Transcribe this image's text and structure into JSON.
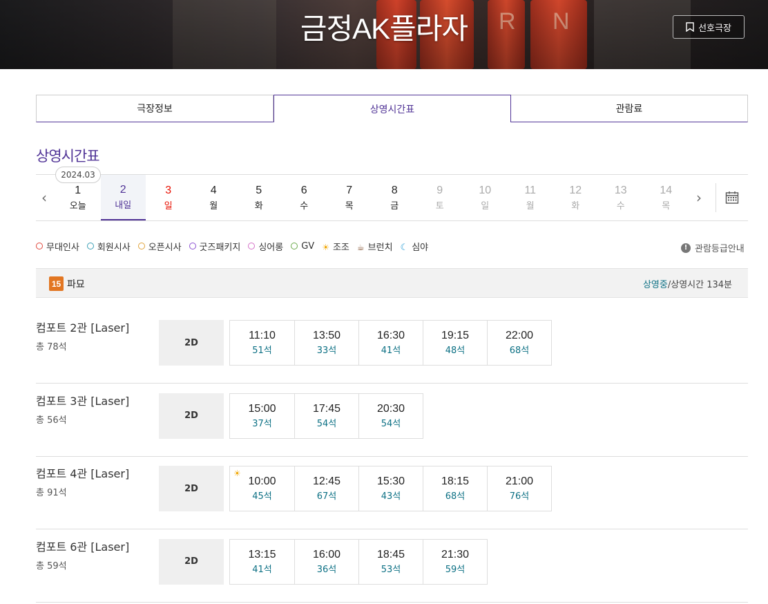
{
  "header": {
    "title": "금정AK플라자",
    "favorite_label": "선호극장",
    "background_letters": [
      "R",
      "N"
    ]
  },
  "tabs": [
    {
      "label": "극장정보",
      "active": false
    },
    {
      "label": "상영시간표",
      "active": true
    },
    {
      "label": "관람료",
      "active": false
    }
  ],
  "section_title": "상영시간표",
  "date_strip": {
    "month": "2024.03",
    "days": [
      {
        "num": "1",
        "dow": "오늘",
        "state": "normal"
      },
      {
        "num": "2",
        "dow": "내일",
        "state": "selected"
      },
      {
        "num": "3",
        "dow": "일",
        "state": "holiday"
      },
      {
        "num": "4",
        "dow": "월",
        "state": "normal"
      },
      {
        "num": "5",
        "dow": "화",
        "state": "normal"
      },
      {
        "num": "6",
        "dow": "수",
        "state": "normal"
      },
      {
        "num": "7",
        "dow": "목",
        "state": "normal"
      },
      {
        "num": "8",
        "dow": "금",
        "state": "normal"
      },
      {
        "num": "9",
        "dow": "토",
        "state": "disabled"
      },
      {
        "num": "10",
        "dow": "일",
        "state": "disabled"
      },
      {
        "num": "11",
        "dow": "월",
        "state": "disabled"
      },
      {
        "num": "12",
        "dow": "화",
        "state": "disabled"
      },
      {
        "num": "13",
        "dow": "수",
        "state": "disabled"
      },
      {
        "num": "14",
        "dow": "목",
        "state": "disabled"
      }
    ]
  },
  "legend": [
    {
      "label": "무대인사",
      "icon": "stage-greeting-icon",
      "color": "#e0453a"
    },
    {
      "label": "회원시사",
      "icon": "member-preview-icon",
      "color": "#3a9fb5"
    },
    {
      "label": "오픈시사",
      "icon": "open-preview-icon",
      "color": "#e0a23a"
    },
    {
      "label": "굿즈패키지",
      "icon": "goods-package-icon",
      "color": "#8a4fd1"
    },
    {
      "label": "싱어롱",
      "icon": "singalong-icon",
      "color": "#d46fc8"
    },
    {
      "label": "GV",
      "icon": "gv-icon",
      "color": "#6aaa4a"
    },
    {
      "label": "조조",
      "icon": "morning-sun-icon",
      "color": "#f0a500"
    },
    {
      "label": "브런치",
      "icon": "brunch-cup-icon",
      "color": "#8a5a3a"
    },
    {
      "label": "심야",
      "icon": "late-night-moon-icon",
      "color": "#2a9fd6"
    }
  ],
  "rating_guide_label": "관람등급안내",
  "movie": {
    "age_rating": "15",
    "title": "파묘",
    "status": "상영중",
    "runtime": "/상영시간 134분"
  },
  "halls": [
    {
      "name": "컴포트 2관 [Laser]",
      "total": "총 78석",
      "format": "2D",
      "times": [
        {
          "t": "11:10",
          "s": "51석",
          "early": false
        },
        {
          "t": "13:50",
          "s": "33석",
          "early": false
        },
        {
          "t": "16:30",
          "s": "41석",
          "early": false
        },
        {
          "t": "19:15",
          "s": "48석",
          "early": false
        },
        {
          "t": "22:00",
          "s": "68석",
          "early": false
        }
      ]
    },
    {
      "name": "컴포트 3관 [Laser]",
      "total": "총 56석",
      "format": "2D",
      "times": [
        {
          "t": "15:00",
          "s": "37석",
          "early": false
        },
        {
          "t": "17:45",
          "s": "54석",
          "early": false
        },
        {
          "t": "20:30",
          "s": "54석",
          "early": false
        }
      ]
    },
    {
      "name": "컴포트 4관 [Laser]",
      "total": "총 91석",
      "format": "2D",
      "times": [
        {
          "t": "10:00",
          "s": "45석",
          "early": true
        },
        {
          "t": "12:45",
          "s": "67석",
          "early": false
        },
        {
          "t": "15:30",
          "s": "43석",
          "early": false
        },
        {
          "t": "18:15",
          "s": "68석",
          "early": false
        },
        {
          "t": "21:00",
          "s": "76석",
          "early": false
        }
      ]
    },
    {
      "name": "컴포트 6관 [Laser]",
      "total": "총 59석",
      "format": "2D",
      "times": [
        {
          "t": "13:15",
          "s": "41석",
          "early": false
        },
        {
          "t": "16:00",
          "s": "36석",
          "early": false
        },
        {
          "t": "18:45",
          "s": "53석",
          "early": false
        },
        {
          "t": "21:30",
          "s": "59석",
          "early": false
        }
      ]
    }
  ]
}
